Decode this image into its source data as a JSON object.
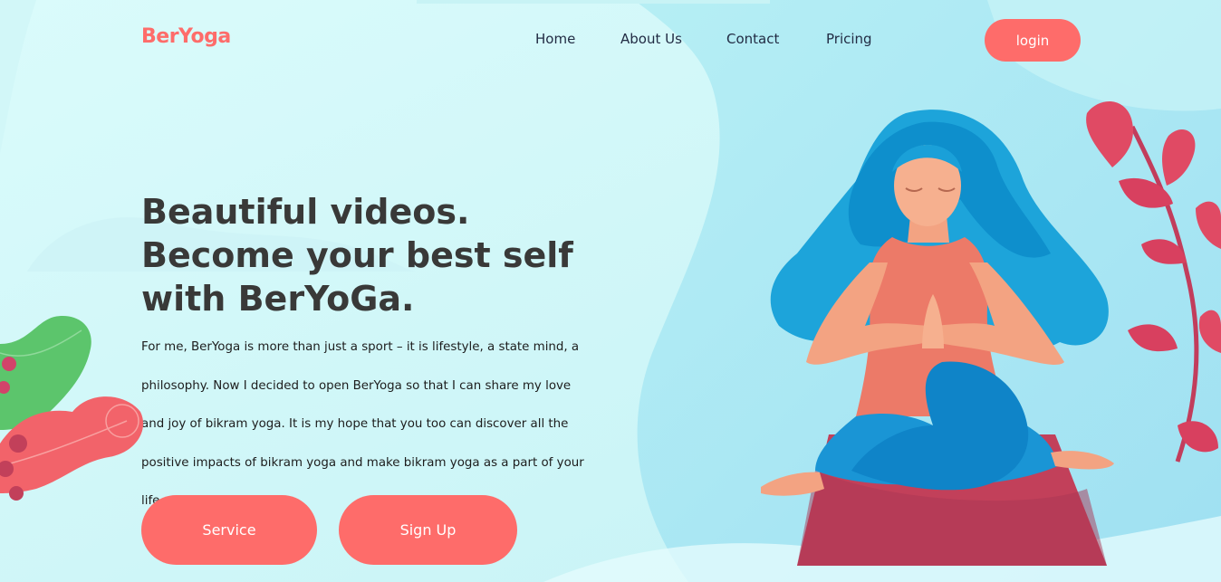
{
  "brand": {
    "logo": "BerYoga",
    "accent_color": "#fe6c6a"
  },
  "nav": {
    "items": [
      {
        "label": "Home"
      },
      {
        "label": "About Us"
      },
      {
        "label": "Contact"
      },
      {
        "label": "Pricing"
      }
    ],
    "login_label": "login"
  },
  "hero": {
    "headline": "Beautiful videos. Become your best self with BerYoGa.",
    "description": "For me, BerYoga is more than just a sport – it is lifestyle, a state mind, a philosophy. Now I decided to open BerYoga so that I can share my love and joy of bikram yoga. It is my hope that you too can discover all the positive impacts of bikram yoga and make bikram yoga as a part of your life.",
    "buttons": {
      "service": "Service",
      "signup": "Sign Up"
    }
  },
  "illustration": {
    "subject": "woman-meditating-yoga",
    "colors": {
      "hair": "#1aa0d8",
      "mat": "#c2405a",
      "leaves": "#e04a64"
    }
  }
}
